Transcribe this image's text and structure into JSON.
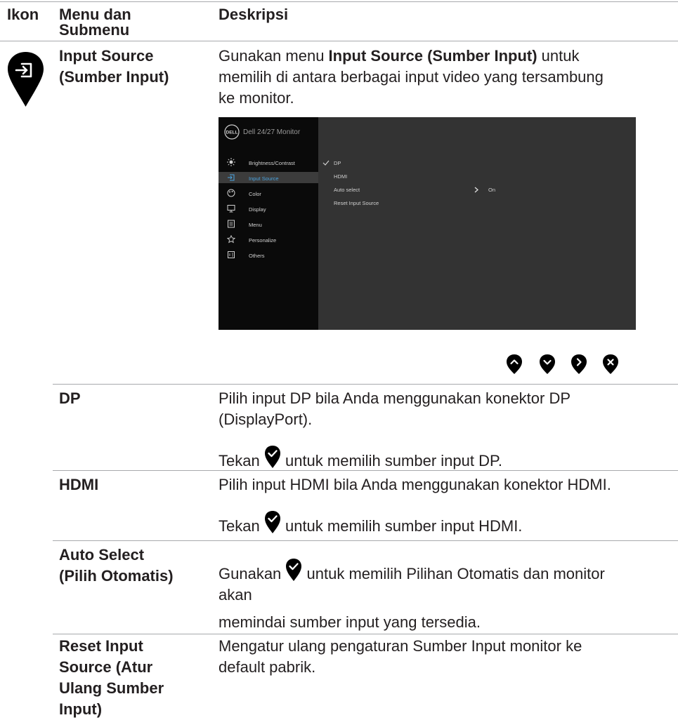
{
  "table": {
    "headers": {
      "icon": "Ikon",
      "menu": "Menu dan Submenu",
      "desc": "Deskripsi"
    },
    "main": {
      "menu": [
        "Input Source",
        "(Sumber Input)"
      ],
      "desc_pre": "Gunakan menu ",
      "desc_bold": "Input Source (Sumber Input)",
      "desc_post": " untuk",
      "desc_l2": "memilih di antara berbagai input video yang tersambung",
      "desc_l3": "ke monitor."
    },
    "rows": [
      {
        "name": "DP",
        "l1": "Pilih input DP bila Anda menggunakan konektor DP",
        "l2": "(DisplayPort).",
        "press_pre": "Tekan",
        "press_post": "untuk memilih sumber input DP."
      },
      {
        "name": "HDMI",
        "l1": "Pilih input HDMI bila Anda menggunakan konektor HDMI.",
        "press_pre": "Tekan",
        "press_post": "untuk memilih sumber input HDMI."
      },
      {
        "name1": "Auto Select",
        "name2": "(Pilih Otomatis)",
        "pre": "Gunakan",
        "post": "untuk memilih Pilihan Otomatis dan monitor",
        "l2": "akan",
        "l3": "memindai sumber input yang tersedia."
      },
      {
        "name1": "Reset Input",
        "name2": "Source (Atur",
        "name3": "Ulang Sumber",
        "name4": "Input)",
        "l1": "Mengatur ulang pengaturan Sumber Input monitor ke",
        "l2": "default pabrik."
      }
    ]
  },
  "osd": {
    "logo": "DELL",
    "title": "Dell 24/27 Monitor",
    "menu": [
      "Brightness/Contrast",
      "Input Source",
      "Color",
      "Display",
      "Menu",
      "Personalize",
      "Others"
    ],
    "menu_icons": [
      "brightness-icon",
      "input-source-icon",
      "color-icon",
      "display-icon",
      "menu-icon",
      "personalize-icon",
      "others-icon"
    ],
    "options": [
      "DP",
      "HDMI",
      "Auto select",
      "Reset Input Source"
    ],
    "auto_select_value": "On"
  },
  "nav_buttons": [
    "up-button-icon",
    "down-button-icon",
    "right-button-icon",
    "close-button-icon"
  ]
}
